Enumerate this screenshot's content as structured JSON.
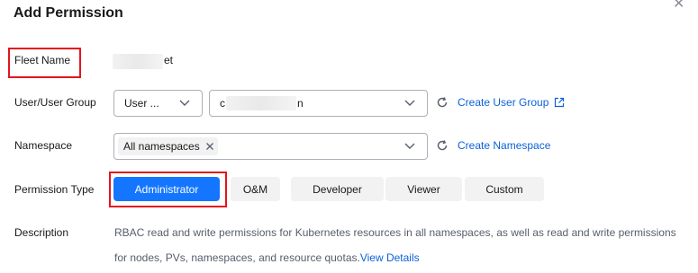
{
  "dialog": {
    "title": "Add Permission"
  },
  "fleet": {
    "label": "Fleet Name",
    "value_suffix": "et"
  },
  "user": {
    "label": "User/User Group",
    "type_value": "User ...",
    "user_value_suffix": "n",
    "create_link": "Create User Group"
  },
  "namespace": {
    "label": "Namespace",
    "tag": "All namespaces",
    "create_link": "Create Namespace"
  },
  "permission": {
    "label": "Permission Type",
    "options": [
      "Administrator",
      "O&M",
      "Developer",
      "Viewer",
      "Custom"
    ],
    "selected": "Administrator"
  },
  "description": {
    "label": "Description",
    "line1": "RBAC read and write permissions for Kubernetes resources in all namespaces, as well as read and write permissions",
    "line2": "for nodes, PVs, namespaces, and resource quotas.",
    "details_link": "View Details"
  },
  "colors": {
    "accent": "#1476ff",
    "link": "#0b62d6",
    "highlight_border": "#e4151c"
  },
  "icons": [
    "close-icon",
    "chevron-down-icon",
    "refresh-icon",
    "external-link-icon",
    "tag-close-icon"
  ]
}
